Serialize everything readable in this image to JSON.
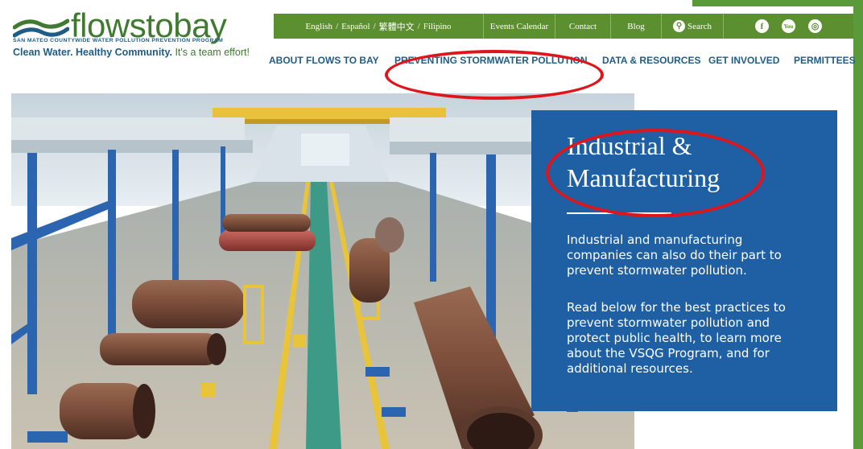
{
  "logo": {
    "wordmark": "flowstobay",
    "program": "SAN MATEO COUNTYWIDE WATER POLLUTION PREVENTION PROGRAM",
    "tagline_main": "Clean Water. Healthy Community.",
    "tagline_end": "It's a team effort!"
  },
  "topbar": {
    "languages": [
      "English",
      "Español",
      "繁體中文",
      "Filipino"
    ],
    "lang_sep": "/",
    "events": "Events Calendar",
    "contact": "Contact",
    "blog": "Blog",
    "search": "Search",
    "social": [
      "f",
      "You",
      "◎"
    ]
  },
  "nav": [
    "ABOUT FLOWS TO BAY",
    "PREVENTING STORMWATER POLLUTION",
    "DATA & RESOURCES",
    "GET INVOLVED",
    "PERMITTEES"
  ],
  "panel": {
    "title": "Industrial & Manufacturing",
    "para1": "Industrial and manufacturing companies can also do their part to prevent stormwater pollution.",
    "para2": "Read below for the best practices to prevent stormwater pollution and protect public health, to learn more about the VSQG Program, and for additional resources."
  },
  "colors": {
    "green": "#5c8f2f",
    "blue": "#1e60a3",
    "nav_blue": "#1f5d86",
    "annotation_red": "#e0151b"
  }
}
